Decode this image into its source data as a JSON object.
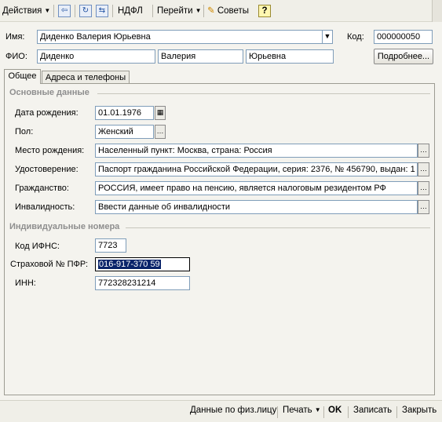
{
  "toolbar": {
    "actions_label": "Действия",
    "ndfl_label": "НДФЛ",
    "goto_label": "Перейти",
    "tips_label": "Советы",
    "help_label": "?"
  },
  "header": {
    "name_label": "Имя:",
    "name_value": "Диденко Валерия Юрьевна",
    "code_label": "Код:",
    "code_value": "000000050",
    "fio_label": "ФИО:",
    "last_name": "Диденко",
    "first_name": "Валерия",
    "middle_name": "Юрьевна",
    "details_button": "Подробнее..."
  },
  "tabs": [
    {
      "label": "Общее",
      "active": true
    },
    {
      "label": "Адреса и телефоны",
      "active": false
    }
  ],
  "basic": {
    "title": "Основные данные",
    "birth_date_label": "Дата рождения:",
    "birth_date": "01.01.1976",
    "gender_label": "Пол:",
    "gender": "Женский",
    "birthplace_label": "Место рождения:",
    "birthplace": "Населенный пункт: Москва, страна: Россия",
    "id_doc_label": "Удостоверение:",
    "id_doc": "Паспорт гражданина Российской Федерации, серия: 2376, № 456790, выдан: 1",
    "citizenship_label": "Гражданство:",
    "citizenship": "РОССИЯ, имеет право на пенсию, является налоговым резидентом РФ",
    "disability_label": "Инвалидность:",
    "disability": "Ввести данные об инвалидности"
  },
  "numbers": {
    "title": "Индивидуальные номера",
    "ifns_label": "Код ИФНС:",
    "ifns": "7723",
    "pfr_label": "Страховой № ПФР:",
    "pfr": "016-917-370 59",
    "inn_label": "ИНН:",
    "inn": "772328231214"
  },
  "footer": {
    "person_data": "Данные по физ.лицу",
    "print": "Печать",
    "ok": "OK",
    "save": "Записать",
    "close": "Закрыть"
  }
}
